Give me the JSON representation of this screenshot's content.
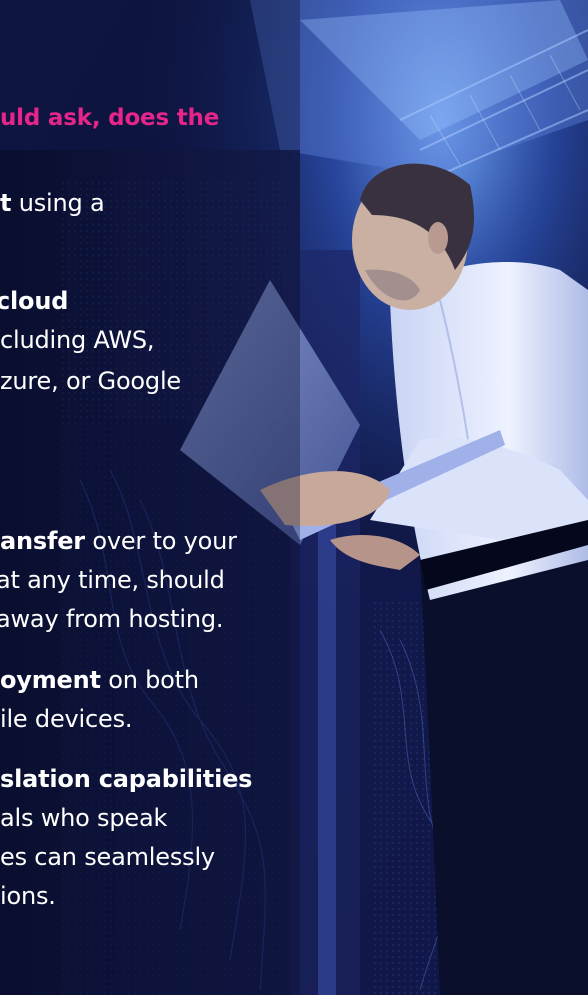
{
  "colors": {
    "accent": "#e6258a",
    "text": "#ffffff",
    "background": "#0b1030"
  },
  "copy": {
    "heading": {
      "line1": "uld ask, does the"
    },
    "item1": {
      "line1_bold": "t",
      "line1_rest": " using a"
    },
    "item2": {
      "line1_bold": " cloud",
      "line2": "cluding AWS,",
      "line3": "zure, or Google"
    },
    "item3": {
      "line1_bold": "ansfer",
      "line1_rest": " over to your",
      "line2": " at any time, should",
      "line3": " away from hosting."
    },
    "item4": {
      "line1_bold": "oyment",
      "line1_rest": " on both",
      "line2": "ile devices."
    },
    "item5": {
      "line1_bold": "slation capabilities",
      "line2": "als who speak",
      "line3": "es can seamlessly",
      "line4": "ions."
    }
  }
}
